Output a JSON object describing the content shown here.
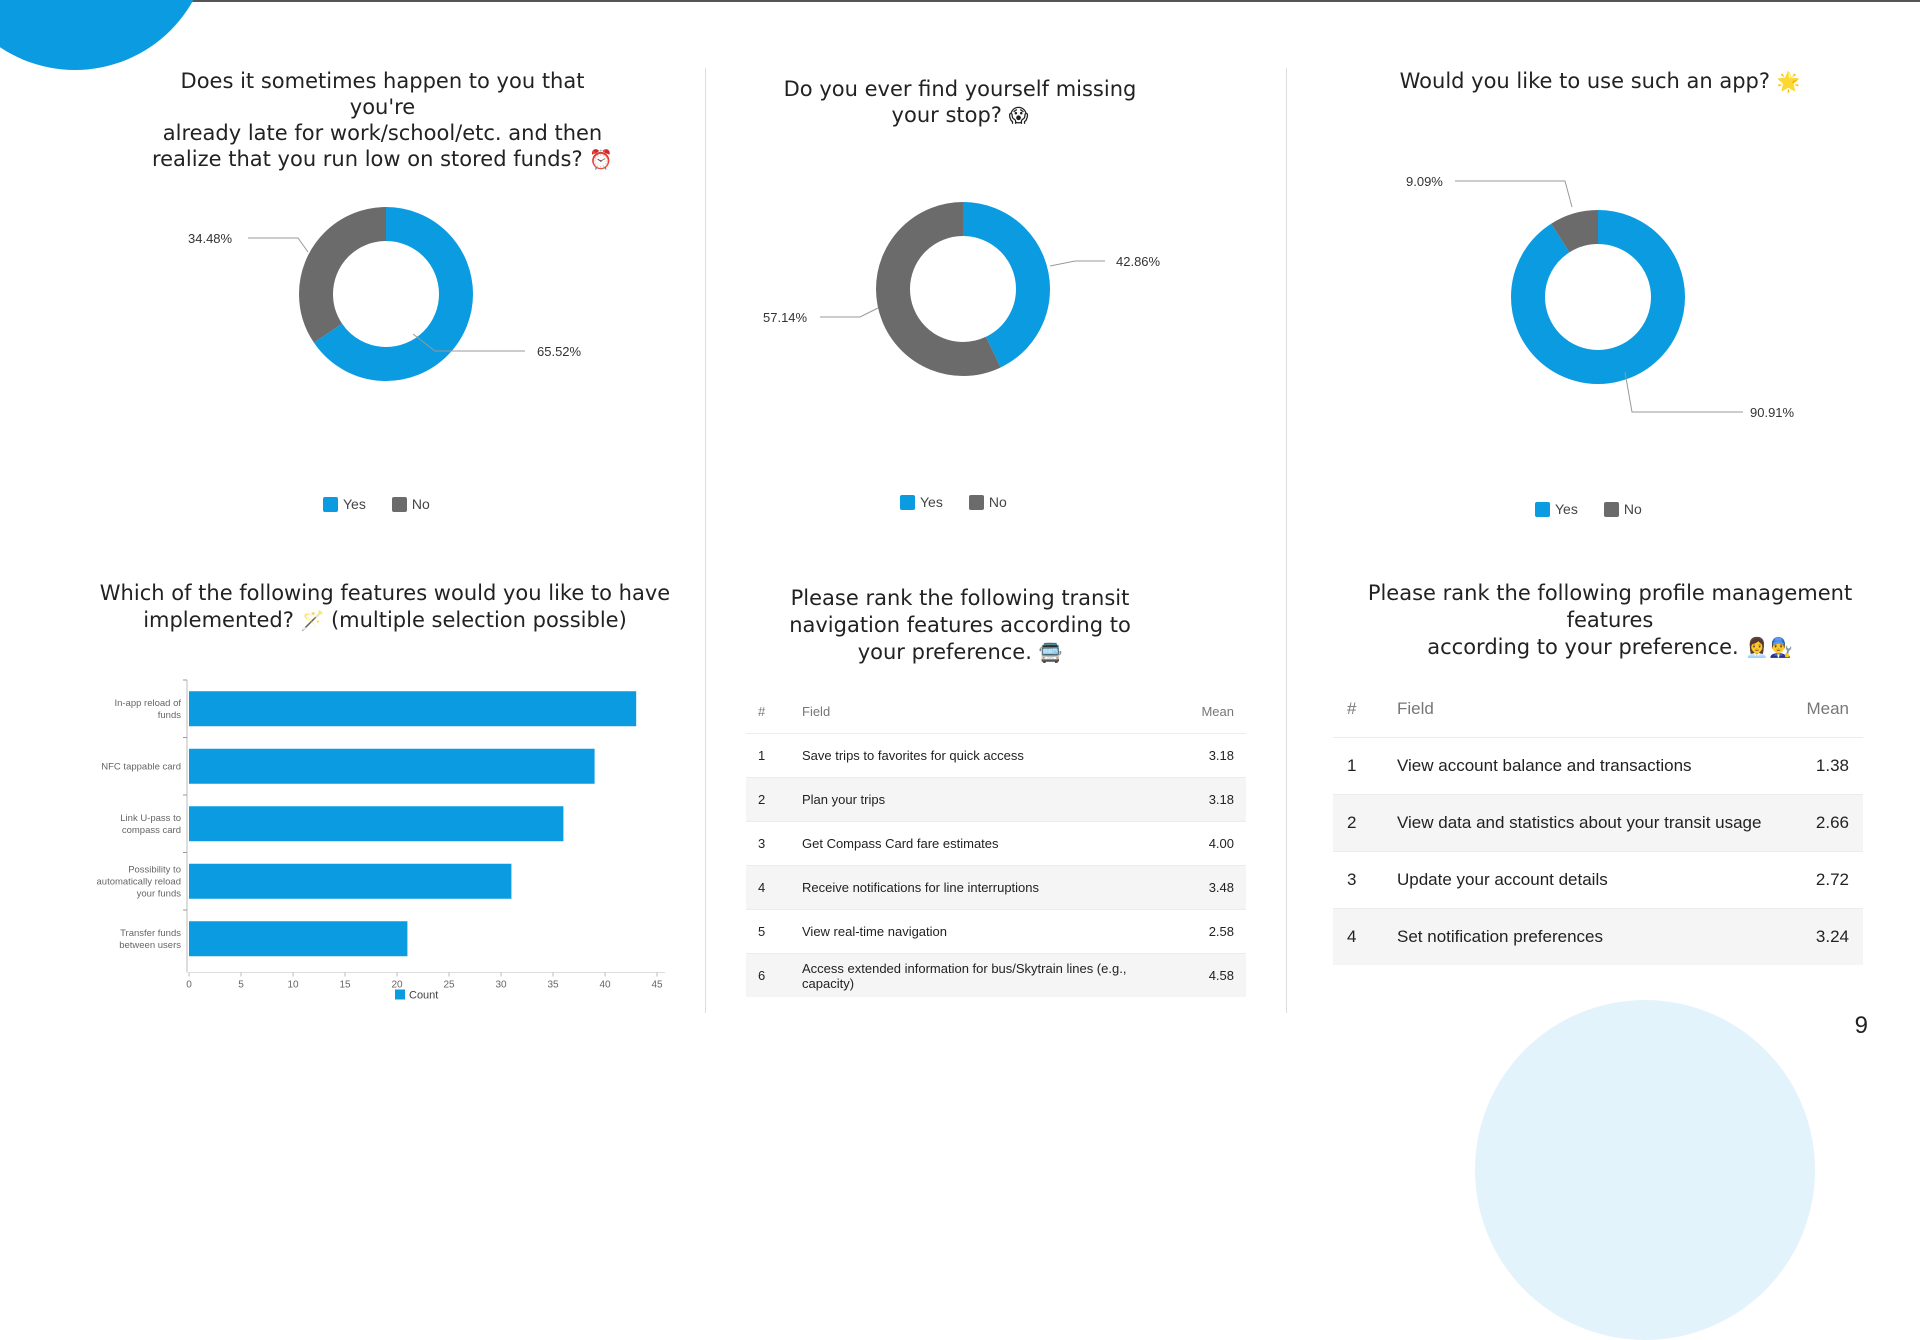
{
  "page": {
    "number": "9"
  },
  "colors": {
    "yes": "#0a9be0",
    "no": "#6b6b6b",
    "bar": "#0a9be0",
    "accent": "#0a9be0"
  },
  "donut_late": {
    "title_lines": [
      "Does it sometimes happen to you that you're",
      "already late for work/school/etc. and then",
      "realize that you run low on stored funds?"
    ],
    "title_emoji": "⏰",
    "labels": {
      "yes": "65.52%",
      "no": "34.48%"
    },
    "legend": {
      "yes": "Yes",
      "no": "No"
    }
  },
  "donut_stop": {
    "title_lines": [
      "Do you ever find yourself missing",
      "your stop?"
    ],
    "title_emoji": "😱",
    "labels": {
      "yes": "42.86%",
      "no": "57.14%"
    },
    "legend": {
      "yes": "Yes",
      "no": "No"
    }
  },
  "donut_app": {
    "title_lines": [
      "Would you like to use such an app?"
    ],
    "title_emoji": "🌟",
    "labels": {
      "yes": "90.91%",
      "no": "9.09%"
    },
    "legend": {
      "yes": "Yes",
      "no": "No"
    }
  },
  "features": {
    "title_lines": [
      "Which of the following features would you like to have",
      "implemented?"
    ],
    "title_emoji": "🪄",
    "title_suffix": "(multiple selection possible)",
    "legend": "Count"
  },
  "transit_rank": {
    "title_lines": [
      "Please rank the following transit",
      "navigation features according to",
      "your preference."
    ],
    "title_emoji": "🚍",
    "headers": {
      "num": "#",
      "field": "Field",
      "mean": "Mean"
    },
    "rows": [
      {
        "num": "1",
        "field": "Save trips to favorites for quick access",
        "mean": "3.18"
      },
      {
        "num": "2",
        "field": "Plan your trips",
        "mean": "3.18"
      },
      {
        "num": "3",
        "field": "Get Compass Card fare estimates",
        "mean": "4.00"
      },
      {
        "num": "4",
        "field": "Receive notifications for line interruptions",
        "mean": "3.48"
      },
      {
        "num": "5",
        "field": "View real-time navigation",
        "mean": "2.58"
      },
      {
        "num": "6",
        "field": "Access extended information for bus/Skytrain lines (e.g., capacity)",
        "mean": "4.58"
      }
    ]
  },
  "profile_rank": {
    "title_lines": [
      "Please rank the following profile management features",
      "according to your preference."
    ],
    "title_emoji": "👩‍💼👨‍🔧",
    "headers": {
      "num": "#",
      "field": "Field",
      "mean": "Mean"
    },
    "rows": [
      {
        "num": "1",
        "field": "View account balance and transactions",
        "mean": "1.38"
      },
      {
        "num": "2",
        "field": "View data and statistics about your transit usage",
        "mean": "2.66"
      },
      {
        "num": "3",
        "field": "Update your account details",
        "mean": "2.72"
      },
      {
        "num": "4",
        "field": "Set notification preferences",
        "mean": "3.24"
      }
    ]
  },
  "chart_data": [
    {
      "type": "pie",
      "variant": "donut",
      "categories": [
        "Yes",
        "No"
      ],
      "values": [
        65.52,
        34.48
      ],
      "data_labels": [
        "65.52%",
        "34.48%"
      ],
      "legend": "bottom"
    },
    {
      "type": "pie",
      "variant": "donut",
      "categories": [
        "Yes",
        "No"
      ],
      "values": [
        42.86,
        57.14
      ],
      "data_labels": [
        "42.86%",
        "57.14%"
      ],
      "legend": "bottom"
    },
    {
      "type": "pie",
      "variant": "donut",
      "categories": [
        "Yes",
        "No"
      ],
      "values": [
        90.91,
        9.09
      ],
      "data_labels": [
        "90.91%",
        "9.09%"
      ],
      "legend": "bottom"
    },
    {
      "type": "bar",
      "orientation": "horizontal",
      "categories": [
        [
          "In-app reload of",
          "funds"
        ],
        [
          "NFC tappable card"
        ],
        [
          "Link U-pass to",
          "compass card"
        ],
        [
          "Possibility to",
          "automatically reload",
          "your funds"
        ],
        [
          "Transfer funds",
          "between users"
        ]
      ],
      "series": [
        {
          "name": "Count",
          "values": [
            43,
            39,
            36,
            31,
            21
          ]
        }
      ],
      "xlim": [
        0,
        45
      ],
      "xticks": [
        0,
        5,
        10,
        15,
        20,
        25,
        30,
        35,
        40,
        45
      ],
      "grid": false,
      "legend": "bottom"
    },
    {
      "type": "table",
      "columns": [
        "#",
        "Field",
        "Mean"
      ],
      "rows": [
        [
          "1",
          "Save trips to favorites for quick access",
          3.18
        ],
        [
          "2",
          "Plan your trips",
          3.18
        ],
        [
          "3",
          "Get Compass Card fare estimates",
          4.0
        ],
        [
          "4",
          "Receive notifications for line interruptions",
          3.48
        ],
        [
          "5",
          "View real-time navigation",
          2.58
        ],
        [
          "6",
          "Access extended information for bus/Skytrain lines (e.g., capacity)",
          4.58
        ]
      ]
    },
    {
      "type": "table",
      "columns": [
        "#",
        "Field",
        "Mean"
      ],
      "rows": [
        [
          "1",
          "View account balance and transactions",
          1.38
        ],
        [
          "2",
          "View data and statistics about your transit usage",
          2.66
        ],
        [
          "3",
          "Update your account details",
          2.72
        ],
        [
          "4",
          "Set notification preferences",
          3.24
        ]
      ]
    }
  ]
}
